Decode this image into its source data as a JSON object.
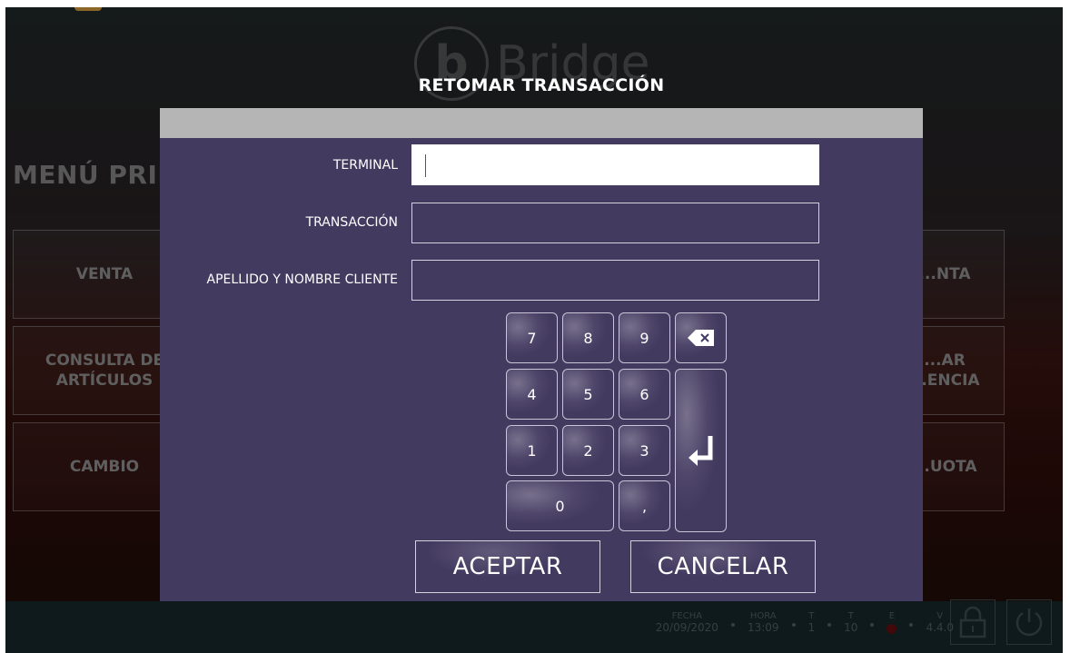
{
  "app": {
    "brand_text": "Bridge",
    "brand_mark": "b",
    "menu_title": "MENÚ PRINCIPAL",
    "tiles": [
      {
        "label": "VENTA"
      },
      {
        "label": "CONSULTA DE ARTÍCULOS"
      },
      {
        "label": "CAMBIO"
      },
      {
        "label": "...NTA"
      },
      {
        "label": "...AR ...ENCIA"
      },
      {
        "label": "...UOTA"
      }
    ]
  },
  "status_bar": {
    "fecha_label": "FECHA",
    "fecha_value": "20/09/2020",
    "hora_label": "HORA",
    "hora_value": "13:09",
    "t1_label": "T",
    "t1_value": "1",
    "t2_label": "T",
    "t2_value": "10",
    "e_label": "E",
    "v_label": "V",
    "v_value": "4.4.0",
    "lock_icon": "lock-icon",
    "power_icon": "power-icon"
  },
  "dialog": {
    "title": "RETOMAR TRANSACCIÓN",
    "fields": {
      "terminal_label": "TERMINAL",
      "terminal_value": "",
      "transaccion_label": "TRANSACCIÓN",
      "transaccion_value": "",
      "cliente_label": "APELLIDO Y NOMBRE CLIENTE",
      "cliente_value": ""
    },
    "keypad": {
      "k7": "7",
      "k8": "8",
      "k9": "9",
      "k4": "4",
      "k5": "5",
      "k6": "6",
      "k1": "1",
      "k2": "2",
      "k3": "3",
      "k0": "0",
      "kcomma": ",",
      "backspace_icon": "backspace-icon",
      "enter_icon": "enter-icon"
    },
    "accept_label": "ACEPTAR",
    "cancel_label": "CANCELAR"
  },
  "colors": {
    "dialog_bg": "#433a60",
    "dialog_header": "#b5b5b5",
    "status_bar_bg": "#172a2c"
  }
}
